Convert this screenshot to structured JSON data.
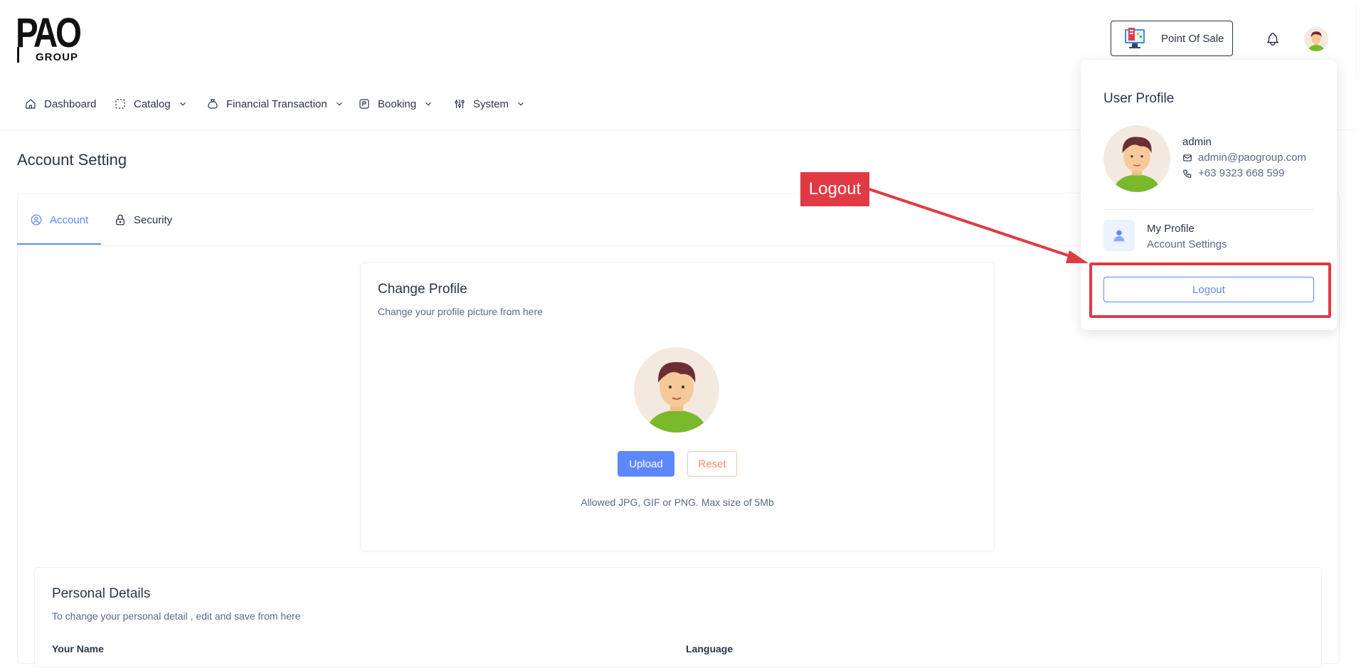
{
  "header": {
    "logo_main": "PAO",
    "logo_sub": "GROUP",
    "pos_button_label": "Point Of Sale"
  },
  "nav": {
    "items": [
      {
        "label": "Dashboard",
        "icon": "home-icon"
      },
      {
        "label": "Catalog",
        "icon": "catalog-icon"
      },
      {
        "label": "Financial Transaction",
        "icon": "money-bag-icon"
      },
      {
        "label": "Booking",
        "icon": "booking-icon"
      },
      {
        "label": "System",
        "icon": "settings-sliders-icon"
      }
    ]
  },
  "page": {
    "title": "Account Setting",
    "tabs": [
      {
        "label": "Account",
        "icon": "user-circle-icon",
        "active": true
      },
      {
        "label": "Security",
        "icon": "lock-icon",
        "active": false
      }
    ]
  },
  "change_profile": {
    "title": "Change Profile",
    "subtitle": "Change your profile picture from here",
    "upload_label": "Upload",
    "reset_label": "Reset",
    "note": "Allowed JPG, GIF or PNG. Max size of 5Mb"
  },
  "personal_details": {
    "title": "Personal Details",
    "subtitle": "To change your personal detail , edit and save from here",
    "name_label": "Your Name",
    "language_label": "Language"
  },
  "user_dropdown": {
    "title": "User Profile",
    "name": "admin",
    "email": "admin@paogroup.com",
    "phone": "+63 9323 668 599",
    "menu_title": "My Profile",
    "menu_sub": "Account Settings",
    "logout_label": "Logout"
  },
  "annotation": {
    "label": "Logout",
    "color": "#e03a44"
  },
  "colors": {
    "primary": "#5d87ff",
    "danger": "#fa896b",
    "text": "#2a3547",
    "muted": "#5a6a85"
  }
}
